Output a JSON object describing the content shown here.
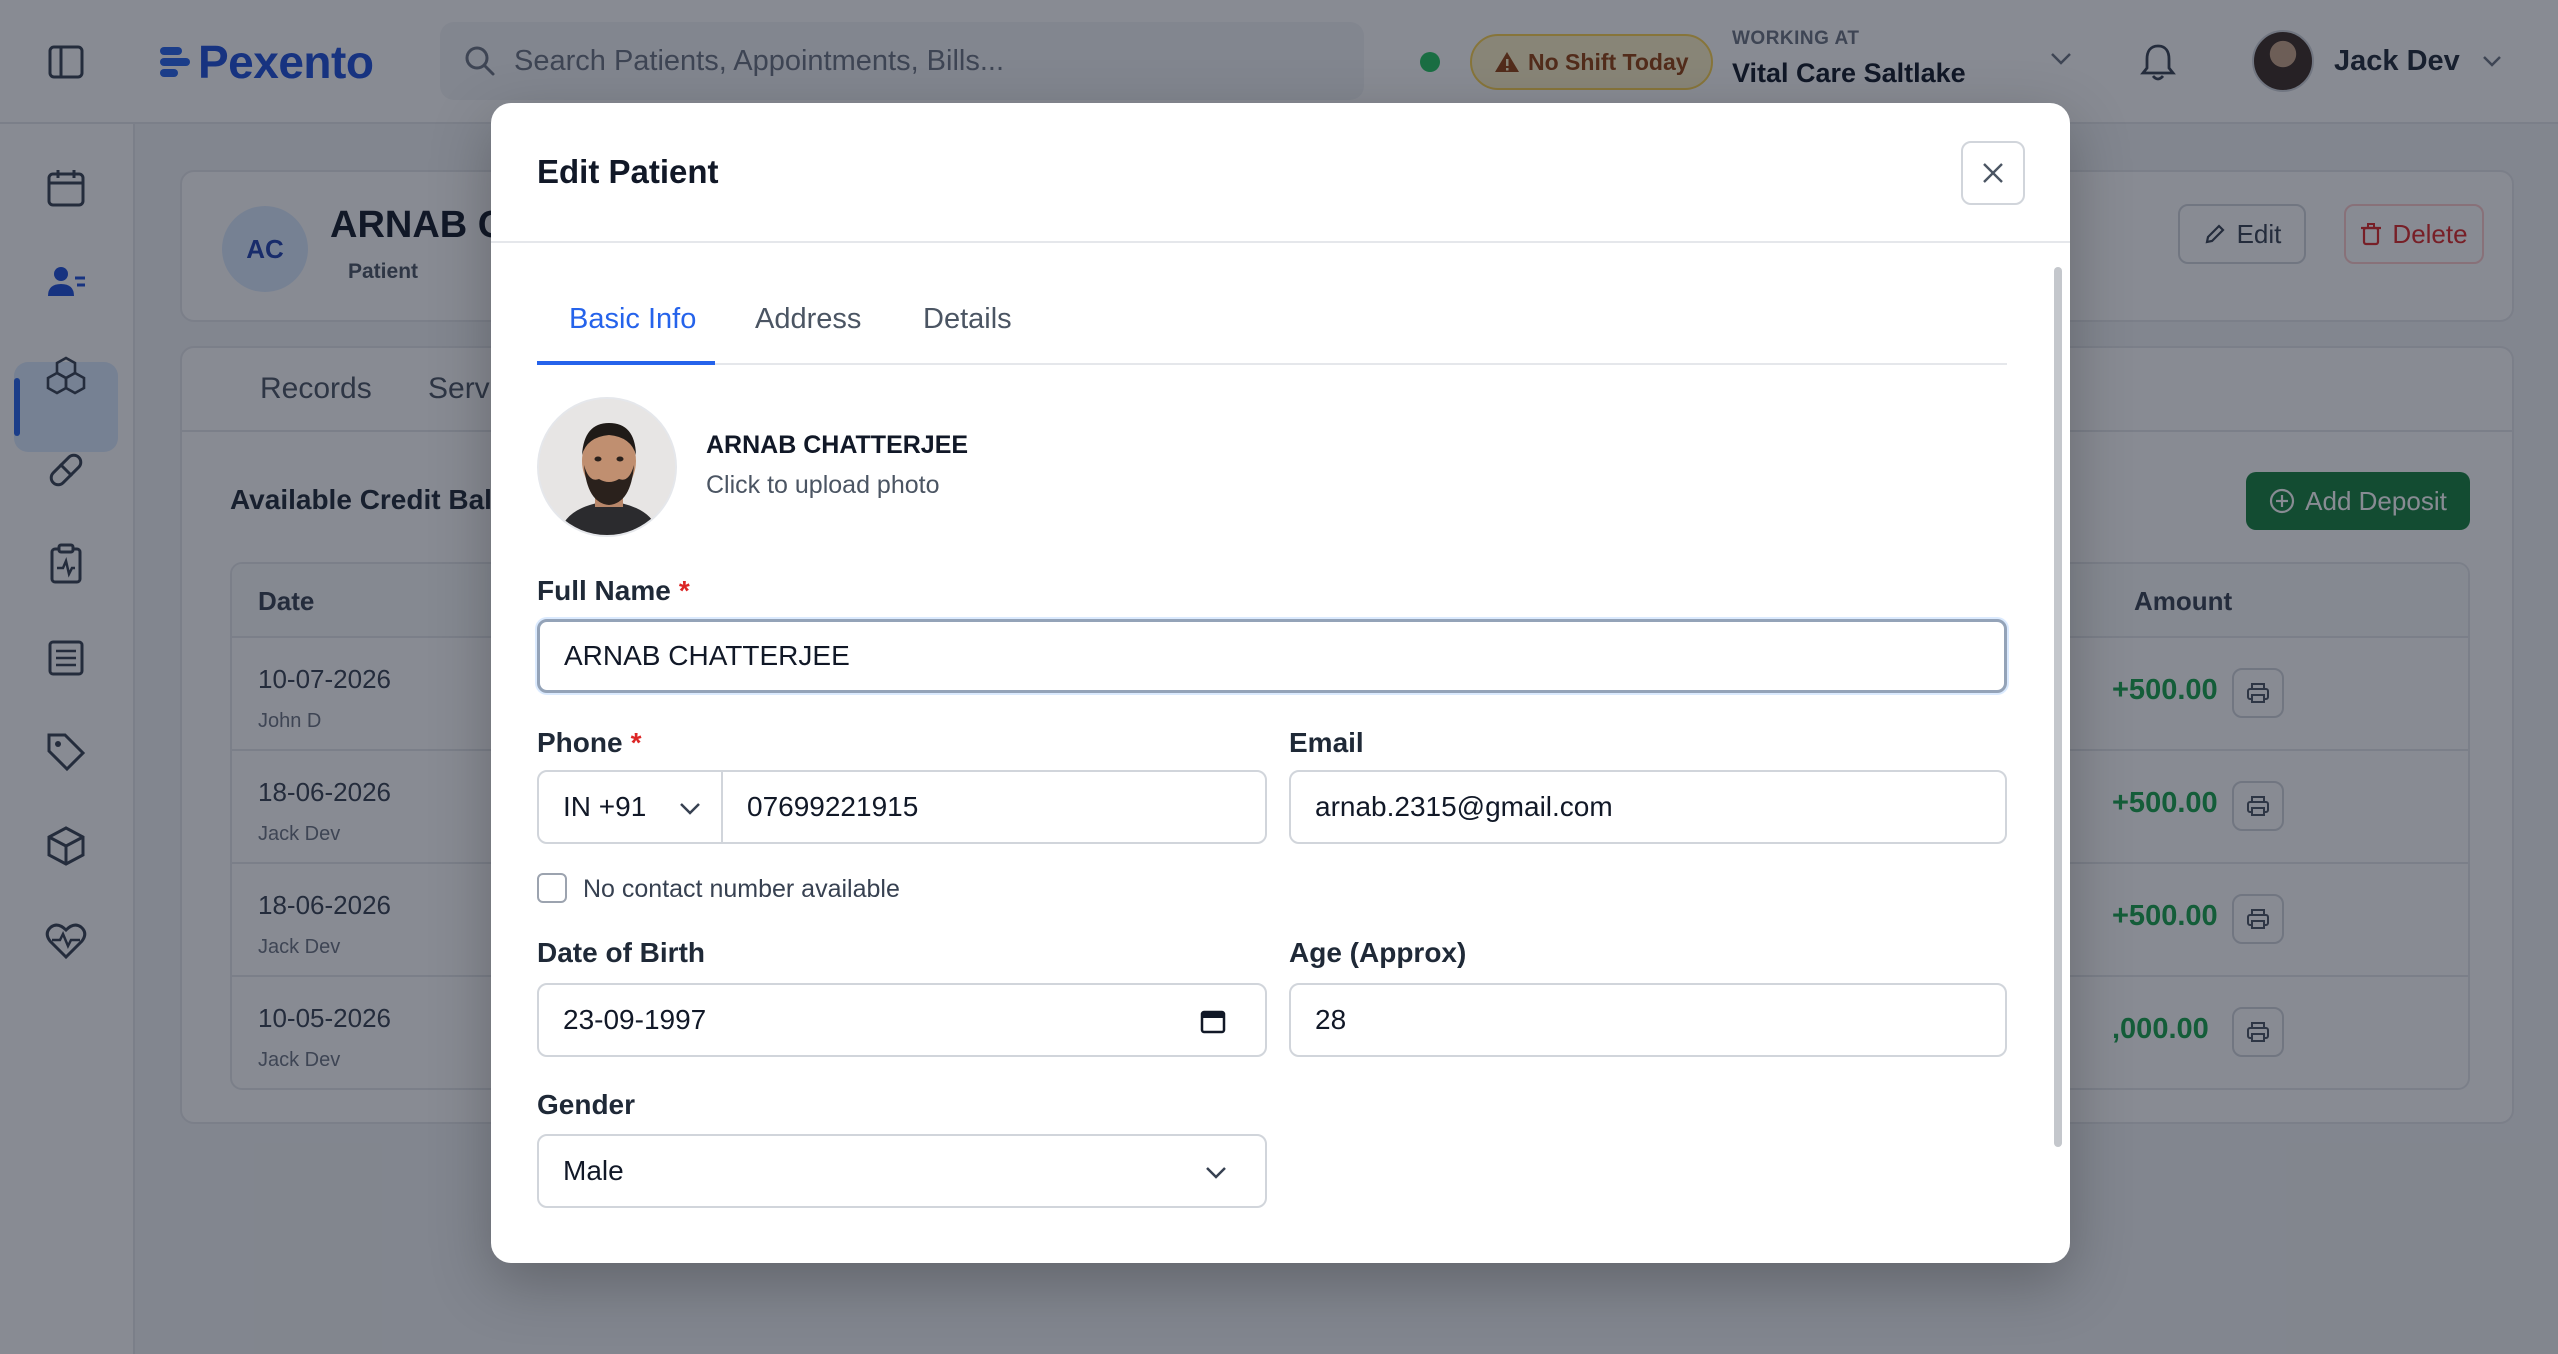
{
  "topbar": {
    "app_name": "Pexento",
    "search_placeholder": "Search Patients, Appointments, Bills...",
    "shift_badge": "No Shift Today",
    "working_at_label": "WORKING AT",
    "working_at_value": "Vital Care Saltlake",
    "user_name": "Jack Dev"
  },
  "sidebar": {
    "items": [
      "calendar-icon",
      "patients-icon",
      "inventory-icon",
      "pill-icon",
      "clipboard-icon",
      "billing-icon",
      "tag-icon",
      "box-icon",
      "health-icon"
    ],
    "active_index": 1
  },
  "patient_header": {
    "initials": "AC",
    "name_visible": "ARNAB CH",
    "role": "Patient",
    "edit_label": "Edit",
    "delete_label": "Delete"
  },
  "background_tabs": [
    "Records",
    "Servi"
  ],
  "credit": {
    "title": "Available Credit Bala",
    "add_deposit_label": "Add Deposit",
    "columns": {
      "date": "Date",
      "amount": "Amount"
    },
    "rows": [
      {
        "date": "10-07-2026",
        "by": "John D",
        "amount": "+500.00"
      },
      {
        "date": "18-06-2026",
        "by": "Jack Dev",
        "amount": "+500.00"
      },
      {
        "date": "18-06-2026",
        "by": "Jack Dev",
        "amount": "+500.00"
      },
      {
        "date": "10-05-2026",
        "by": "Jack Dev",
        "amount": ",000.00"
      }
    ]
  },
  "modal": {
    "title": "Edit Patient",
    "tabs": [
      "Basic Info",
      "Address",
      "Details"
    ],
    "active_tab": "Basic Info",
    "photo_name": "ARNAB CHATTERJEE",
    "upload_hint": "Click to upload photo",
    "full_name_label": "Full Name",
    "full_name_value": "ARNAB CHATTERJEE",
    "required_mark": "*",
    "phone_label": "Phone",
    "country_code": "IN +91",
    "phone_value": "07699221915",
    "email_label": "Email",
    "email_value": "arnab.2315@gmail.com",
    "no_contact_label": "No contact number available",
    "dob_label": "Date of Birth",
    "dob_value": "23-09-1997",
    "age_label": "Age (Approx)",
    "age_value": "28",
    "gender_label": "Gender",
    "gender_value": "Male"
  },
  "colors": {
    "brand": "#2563eb",
    "danger": "#dc2626",
    "success": "#15803d",
    "warning_bg": "#fef3c7"
  }
}
